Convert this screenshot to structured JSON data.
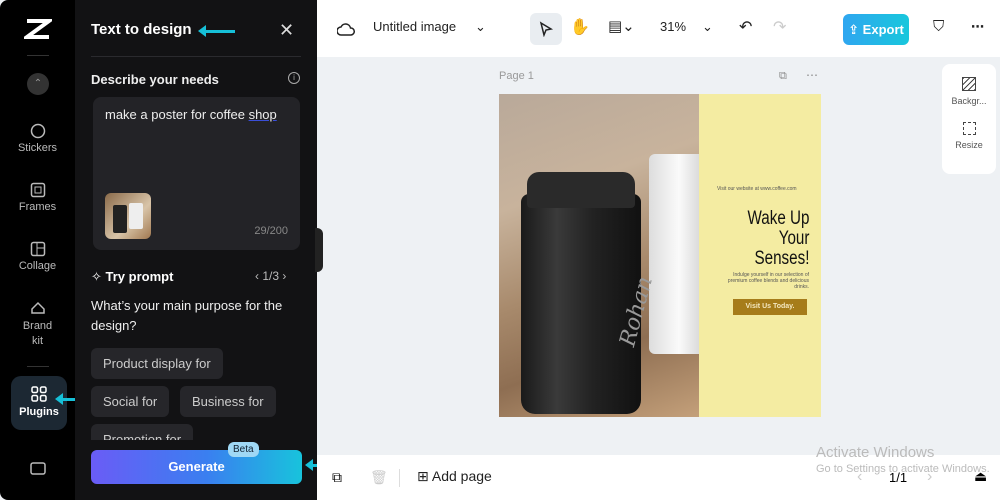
{
  "rail": {
    "items": [
      {
        "label": "Stickers"
      },
      {
        "label": "Frames"
      },
      {
        "label": "Collage"
      },
      {
        "label": "Brand kit"
      },
      {
        "label": "Plugins"
      }
    ]
  },
  "panel": {
    "title": "Text to design",
    "describe_label": "Describe your needs",
    "prompt_text": "make a poster for coffee ",
    "prompt_text_underlined": "shop",
    "char_count": "29/200",
    "try_prompt": "Try prompt",
    "pager": "1/3",
    "question": "What’s your main purpose for the design?",
    "chips": [
      "Product display for",
      "Social for",
      "Business for",
      "Promotion for"
    ],
    "generate": "Generate",
    "beta": "Beta"
  },
  "topbar": {
    "file_name": "Untitled image",
    "zoom": "31%",
    "export": "Export"
  },
  "canvas": {
    "page_label": "Page 1",
    "poster": {
      "website": "Visit our website at www.coffee.com",
      "headline": [
        "Wake Up",
        "Your",
        "Senses!"
      ],
      "tagline": "Indulge yourself in our selection of premium coffee blends and delicious drinks.",
      "button": "Visit Us Today.",
      "brand_text": "Rohan"
    }
  },
  "side_tools": [
    {
      "label": "Backgr..."
    },
    {
      "label": "Resize"
    }
  ],
  "bottombar": {
    "add_page": "Add page",
    "page_count": "1/1"
  },
  "watermark": {
    "title": "Activate Windows",
    "subtitle": "Go to Settings to activate Windows."
  },
  "colors": {
    "accent": "#16c0d8",
    "export": "#18c7dc",
    "poster_yellow": "#f4eca2",
    "poster_button": "#a67c1a"
  }
}
